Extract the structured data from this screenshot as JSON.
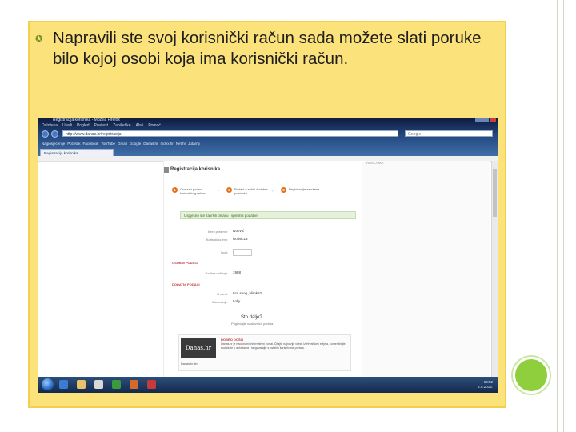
{
  "slide": {
    "bullet_text": "Napravili ste svoj korisnički račun sada možete slati poruke bilo kojoj osobi koja ima korisnički račun."
  },
  "browser": {
    "title": "Registracija korisnika - Mozilla Firefox",
    "menu": [
      "Datoteka",
      "Uredi",
      "Pogled",
      "Povijest",
      "Zabilješke",
      "Alati",
      "Pomoć"
    ],
    "url": "http://www.danas.hr/registracija",
    "search_placeholder": "Google",
    "bookmarks": [
      "Najposjećenije",
      "Početak",
      "Facebook",
      "YouTube",
      "Gmail",
      "Google",
      "Danas.hr",
      "Index.hr",
      "Net.hr",
      "Jutarnji"
    ],
    "tab_label": "Registracija korisnika"
  },
  "page": {
    "side_label": "REKLAMA",
    "reg_title": "Registracija korisnika",
    "steps": [
      {
        "num": "1",
        "text": "Osnovni podaci korisničkog računa"
      },
      {
        "num": "2",
        "text": "Podaci o sebi i dodatne postavke"
      },
      {
        "num": "3",
        "text": "Registracija završena"
      }
    ],
    "success_msg": "Uspješno ste završili prijavu i spremili podatke.",
    "fields": [
      {
        "label": "Ime i prezime:",
        "value": "Ivo Ivić"
      },
      {
        "label": "Korisničko ime:",
        "value": "ivo.ivic13"
      }
    ],
    "field_spol_label": "Spol:",
    "section1": "OSOBNI PODACI",
    "rodjenje_label": "Godina rođenja:",
    "rodjenje_value": "1988",
    "section2": "DODATNI PODACI",
    "extra_fields": [
      {
        "label": "O meni:",
        "value": "Ivo, svog ,ulimka?"
      },
      {
        "label": "Zanimanje:",
        "value": "Lolly"
      }
    ],
    "shto_title": "Što dalje?",
    "shto_sub": "Pogledajte naslovnicu portala",
    "ad": {
      "logo": "Danas.hr",
      "head": "DOBRO DOŠLI",
      "text": "Danas.hr je nacionalni informativni portal. Čitajte najnovije vijesti iz Hrvatske i svijeta, komentirajte, sudjelujte u anketama i razgovarajte s ostalim korisnicima portala.",
      "foot": "Danas.hr tim"
    }
  },
  "taskbar": {
    "time": "10:52",
    "date": "2.5.2013."
  },
  "colors": {
    "slide_bg": "#fbe27a",
    "accent_green": "#8fce3d",
    "step_orange": "#e4701e"
  }
}
